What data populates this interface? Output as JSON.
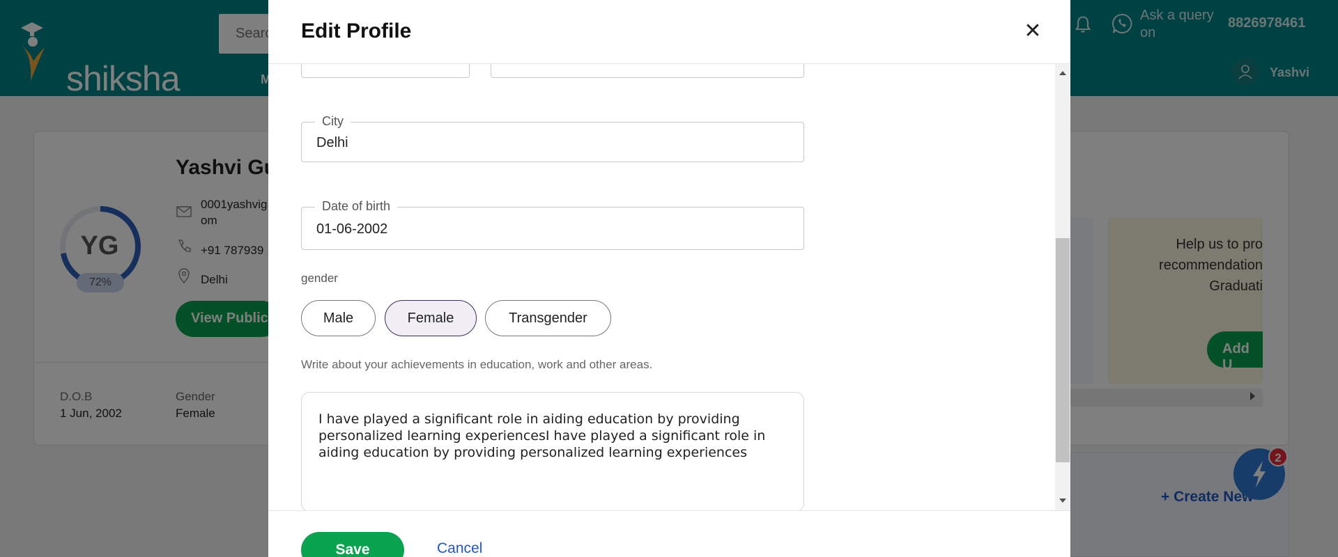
{
  "header": {
    "logo_text": "shiksha",
    "search_placeholder": "Search",
    "nav_fragment": "M",
    "ask_query": "Ask a query on",
    "phone": "8826978461",
    "user_name": "Yashvi",
    "color": "#008489"
  },
  "profile_card": {
    "initials": "YG",
    "completion": "72%",
    "completion_fraction": 0.72,
    "name": "Yashvi Gu",
    "email_line1": "0001yashvig",
    "email_line2": "om",
    "phone": "+91 787939",
    "city": "Delhi",
    "view_public": "View Public",
    "dob_label": "D.O.B",
    "dob_value": "1 Jun, 2002",
    "gender_label": "Gender",
    "gender_value": "Female",
    "help_text_line1": "Help us to pro",
    "help_text_line2": "recommendation",
    "help_text_line3": "Graduati",
    "add_button": "Add U",
    "create_new": "+ Create New",
    "notification_count": "2"
  },
  "modal": {
    "title": "Edit Profile",
    "close_symbol": "✕",
    "city_label": "City",
    "city_value": "Delhi",
    "dob_label": "Date of birth",
    "dob_value": "01-06-2002",
    "gender_heading": "gender",
    "gender_options": [
      "Male",
      "Female",
      "Transgender"
    ],
    "selected_gender": "Female",
    "achievements_help": "Write about your achievements in education, work and other areas.",
    "achievements_text": "I have played a significant role in aiding education by providing personalized learning experiencesI have played a significant role in aiding education by providing personalized learning experiences",
    "save_label": "Save",
    "cancel_label": "Cancel"
  },
  "colors": {
    "primary_green": "#0aa34f",
    "link_blue": "#2057c5",
    "selected_pill_border": "#3a2d58",
    "ring_blue": "#2e5fb8"
  }
}
